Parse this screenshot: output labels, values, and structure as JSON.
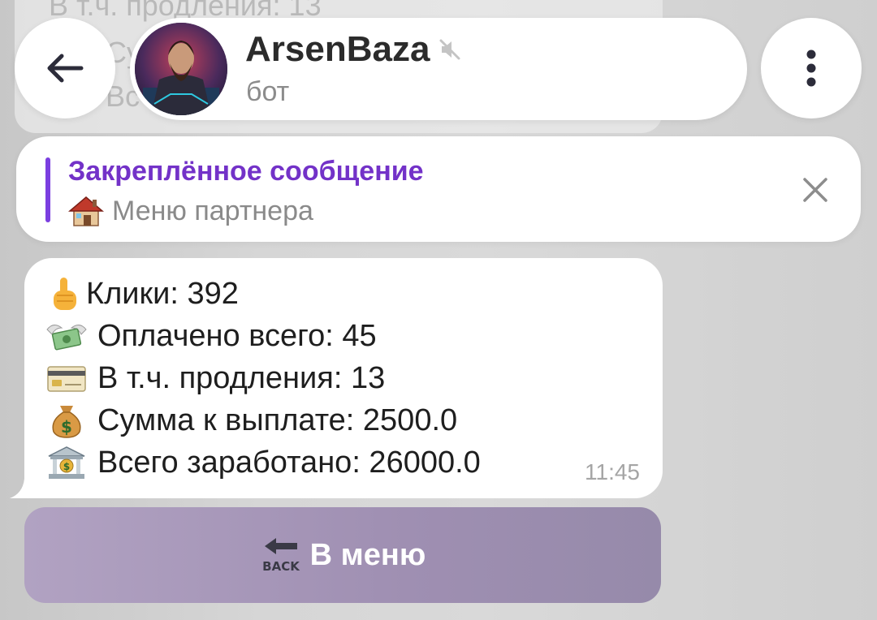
{
  "background_message": {
    "lines": [
      "В т.ч. продления: 13",
      "Су",
      "Вс"
    ]
  },
  "header": {
    "back_icon": "arrow-left-icon",
    "chat_name": "ArsenBaza",
    "muted_icon": "speaker-muted-icon",
    "subtitle": "бот",
    "menu_icon": "kebab-menu-icon"
  },
  "pinned": {
    "title": "Закреплённое сообщение",
    "text": "Меню партнера",
    "emoji": "house-icon",
    "accent_color": "#7b3fe0"
  },
  "message": {
    "lines": [
      {
        "icon": "pointing-finger-icon",
        "text": "Клики: 392"
      },
      {
        "icon": "money-wings-icon",
        "text": "Оплачено всего: 45"
      },
      {
        "icon": "credit-card-icon",
        "text": "В т.ч. продления: 13"
      },
      {
        "icon": "money-bag-icon",
        "text": "Сумма к выплате: 2500.0"
      },
      {
        "icon": "bank-icon",
        "text": "Всего заработано: 26000.0"
      }
    ],
    "time": "11:45"
  },
  "keyboard": {
    "button_icon": "back-arrow-icon",
    "button_icon_text": "BACK",
    "button_label": "В меню"
  }
}
